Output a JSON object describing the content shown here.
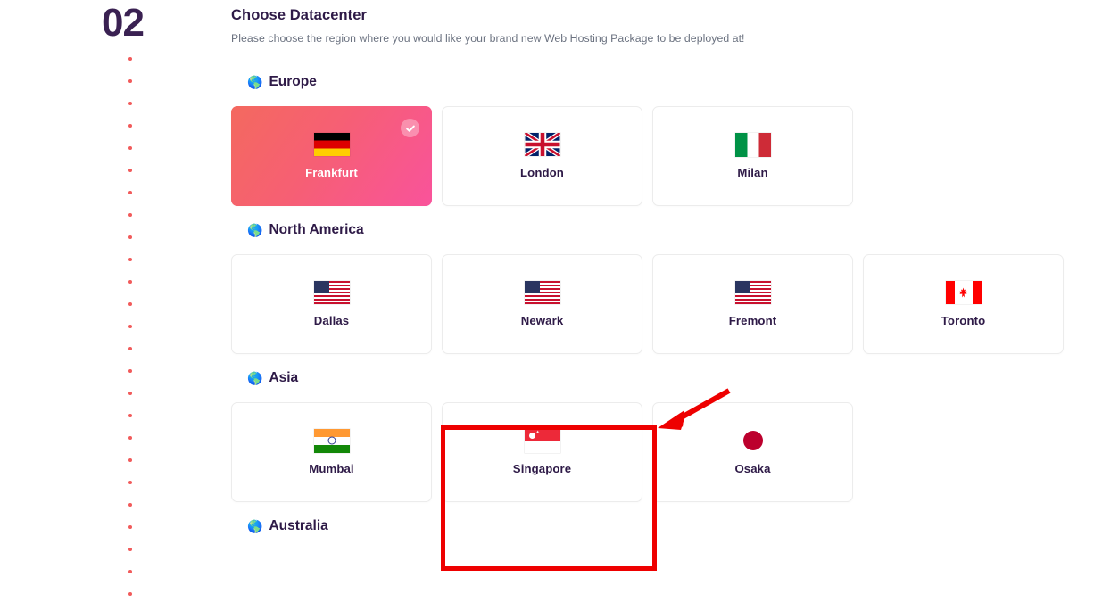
{
  "step": {
    "number": "02",
    "title": "Choose Datacenter",
    "subtitle": "Please choose the region where you would like your brand new Web Hosting Package to be deployed at!",
    "dot_count": 25,
    "dot_color": "#f15b5b",
    "number_color": "#3a2152"
  },
  "colors": {
    "selected_gradient_start": "#f4695f",
    "selected_gradient_end": "#f9539b",
    "card_border": "#ececec",
    "heading": "#2e1a47",
    "subtitle": "#6b7280",
    "annotation": "#ee0000"
  },
  "regions": [
    {
      "name": "Europe",
      "icon": "globe-europe-icon",
      "datacenters": [
        {
          "label": "Frankfurt",
          "flag": "de-flag-icon",
          "selected": true
        },
        {
          "label": "London",
          "flag": "gb-flag-icon",
          "selected": false
        },
        {
          "label": "Milan",
          "flag": "it-flag-icon",
          "selected": false
        }
      ]
    },
    {
      "name": "North America",
      "icon": "globe-americas-icon",
      "datacenters": [
        {
          "label": "Dallas",
          "flag": "us-flag-icon",
          "selected": false
        },
        {
          "label": "Newark",
          "flag": "us-flag-icon",
          "selected": false
        },
        {
          "label": "Fremont",
          "flag": "us-flag-icon",
          "selected": false
        },
        {
          "label": "Toronto",
          "flag": "ca-flag-icon",
          "selected": false
        }
      ]
    },
    {
      "name": "Asia",
      "icon": "globe-asia-icon",
      "datacenters": [
        {
          "label": "Mumbai",
          "flag": "in-flag-icon",
          "selected": false
        },
        {
          "label": "Singapore",
          "flag": "sg-flag-icon",
          "selected": false,
          "annotated": true
        },
        {
          "label": "Osaka",
          "flag": "jp-flag-icon",
          "selected": false
        }
      ]
    },
    {
      "name": "Australia",
      "icon": "globe-asia-icon",
      "datacenters": []
    }
  ],
  "annotation": {
    "box_target": "Singapore",
    "arrow": "red-arrow-pointing-to-singapore-card"
  }
}
